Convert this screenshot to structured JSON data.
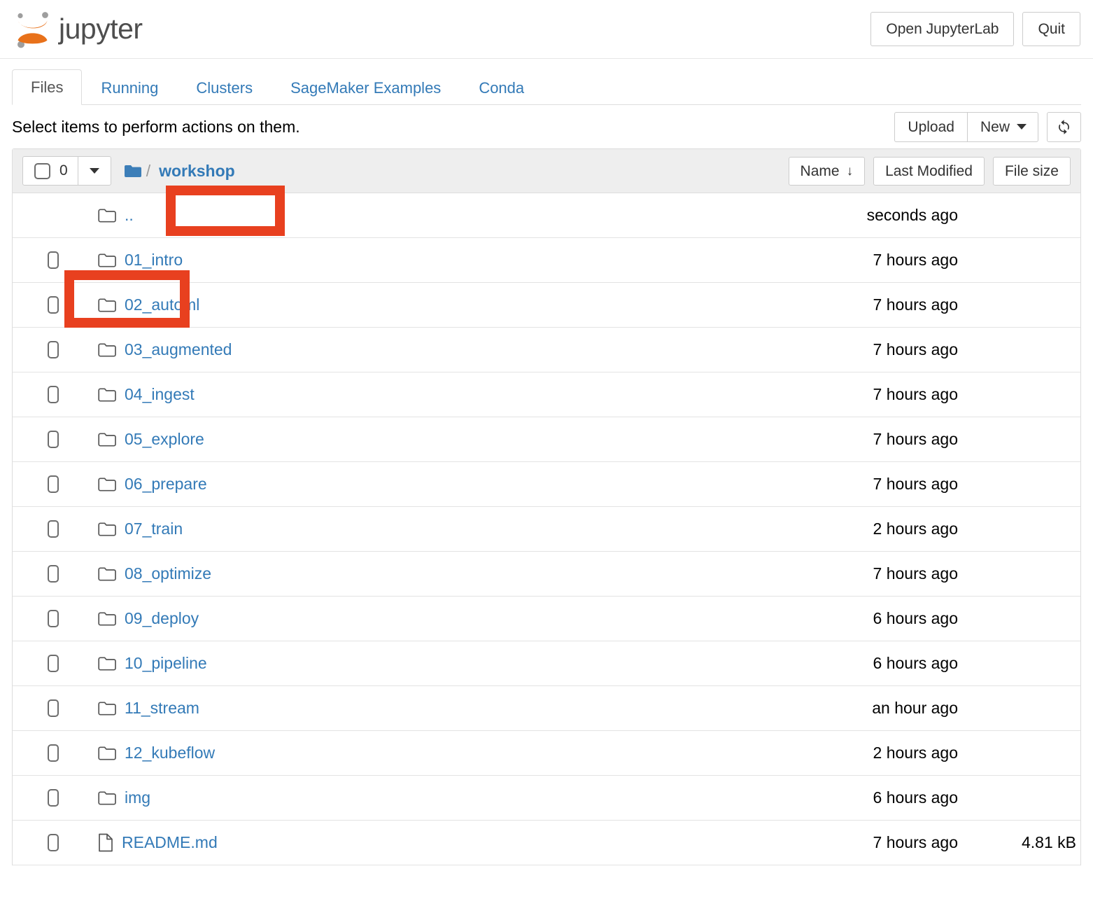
{
  "brand": {
    "name": "jupyter",
    "logo_icon": "jupyter-logo-icon"
  },
  "header": {
    "open_lab_label": "Open JupyterLab",
    "quit_label": "Quit"
  },
  "tabs": [
    {
      "label": "Files",
      "active": true
    },
    {
      "label": "Running",
      "active": false
    },
    {
      "label": "Clusters",
      "active": false
    },
    {
      "label": "SageMaker Examples",
      "active": false
    },
    {
      "label": "Conda",
      "active": false
    }
  ],
  "actionbar": {
    "select_hint": "Select items to perform actions on them.",
    "upload_label": "Upload",
    "new_label": "New",
    "refresh_icon": "refresh-icon"
  },
  "list_header": {
    "selected_count": "0",
    "breadcrumb_separator": "/",
    "breadcrumb_current": "workshop",
    "sort_name": "Name",
    "sort_name_arrow": "↓",
    "sort_last_modified": "Last Modified",
    "sort_file_size": "File size"
  },
  "rows": [
    {
      "name": "..",
      "type": "folder",
      "modified": "seconds ago",
      "size": "",
      "checkbox": false
    },
    {
      "name": "01_intro",
      "type": "folder",
      "modified": "7 hours ago",
      "size": "",
      "checkbox": true
    },
    {
      "name": "02_automl",
      "type": "folder",
      "modified": "7 hours ago",
      "size": "",
      "checkbox": true
    },
    {
      "name": "03_augmented",
      "type": "folder",
      "modified": "7 hours ago",
      "size": "",
      "checkbox": true
    },
    {
      "name": "04_ingest",
      "type": "folder",
      "modified": "7 hours ago",
      "size": "",
      "checkbox": true
    },
    {
      "name": "05_explore",
      "type": "folder",
      "modified": "7 hours ago",
      "size": "",
      "checkbox": true
    },
    {
      "name": "06_prepare",
      "type": "folder",
      "modified": "7 hours ago",
      "size": "",
      "checkbox": true
    },
    {
      "name": "07_train",
      "type": "folder",
      "modified": "2 hours ago",
      "size": "",
      "checkbox": true
    },
    {
      "name": "08_optimize",
      "type": "folder",
      "modified": "7 hours ago",
      "size": "",
      "checkbox": true
    },
    {
      "name": "09_deploy",
      "type": "folder",
      "modified": "6 hours ago",
      "size": "",
      "checkbox": true
    },
    {
      "name": "10_pipeline",
      "type": "folder",
      "modified": "6 hours ago",
      "size": "",
      "checkbox": true
    },
    {
      "name": "11_stream",
      "type": "folder",
      "modified": "an hour ago",
      "size": "",
      "checkbox": true
    },
    {
      "name": "12_kubeflow",
      "type": "folder",
      "modified": "2 hours ago",
      "size": "",
      "checkbox": true
    },
    {
      "name": "img",
      "type": "folder",
      "modified": "6 hours ago",
      "size": "",
      "checkbox": true
    },
    {
      "name": "README.md",
      "type": "file",
      "modified": "7 hours ago",
      "size": "4.81 kB",
      "checkbox": true
    }
  ],
  "annotations": [
    {
      "id": "annot-workshop",
      "target": "workshop",
      "color": "#e8401f"
    },
    {
      "id": "annot-intro",
      "target": "01_intro",
      "color": "#e8401f"
    }
  ],
  "colors": {
    "link": "#337ab7",
    "annotation": "#e8401f",
    "logo_orange": "#e8711a",
    "header_bg": "#eeeeee"
  }
}
